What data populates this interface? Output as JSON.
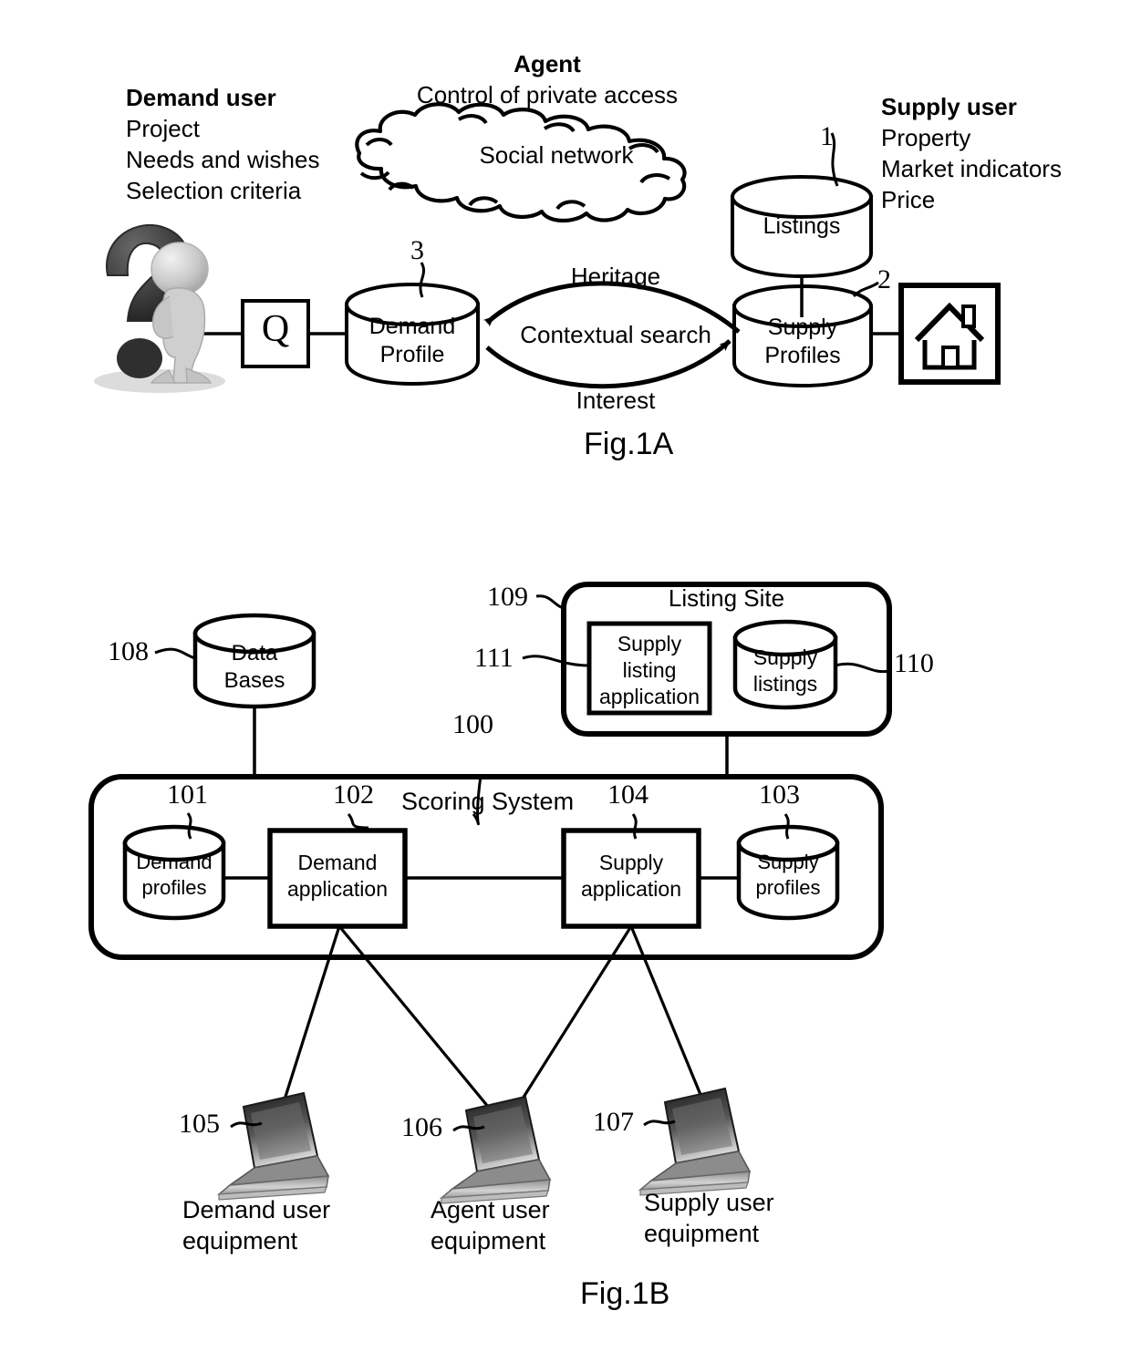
{
  "figures": {
    "fig_a": {
      "caption": "Fig.1A",
      "demand_user": {
        "title": "Demand user",
        "lines": [
          "Project",
          "Needs and wishes",
          "Selection criteria"
        ]
      },
      "agent": {
        "title": "Agent",
        "subtitle": "Control of private access"
      },
      "supply_user": {
        "title": "Supply user",
        "lines": [
          "Property",
          "Market indicators",
          "Price"
        ]
      },
      "cloud_label": "Social network",
      "search_box_label": "Q",
      "nodes": [
        {
          "id": "listings",
          "label": "Listings",
          "ref": "1"
        },
        {
          "id": "supply-profiles",
          "label_line1": "Supply",
          "label_line2": "Profiles",
          "ref": "2"
        },
        {
          "id": "demand-profile",
          "label_line1": "Demand",
          "label_line2": "Profile",
          "ref": "3"
        }
      ],
      "arrow_labels": {
        "top": "Heritage",
        "middle": "Contextual search",
        "bottom": "Interest"
      },
      "house_icon": "house-icon",
      "person_icon": "question-mark-person-icon"
    },
    "fig_b": {
      "caption": "Fig.1B",
      "databases": {
        "label_line1": "Data",
        "label_line2": "Bases",
        "ref": "108"
      },
      "listing_site": {
        "title": "Listing Site",
        "ref": "109",
        "application": {
          "line1": "Supply",
          "line2": "listing",
          "line3": "application",
          "ref": "111"
        },
        "listings_db": {
          "line1": "Supply",
          "line2": "listings",
          "ref": "110"
        }
      },
      "scoring_system": {
        "title": "Scoring System",
        "ref": "100",
        "demand_profiles": {
          "line1": "Demand",
          "line2": "profiles",
          "ref": "101"
        },
        "demand_application": {
          "line1": "Demand",
          "line2": "application",
          "ref": "102"
        },
        "supply_application": {
          "line1": "Supply",
          "line2": "application",
          "ref": "104"
        },
        "supply_profiles": {
          "line1": "Supply",
          "line2": "profiles",
          "ref": "103"
        }
      },
      "equipment": [
        {
          "id": "demand",
          "ref": "105",
          "line1": "Demand user",
          "line2": "equipment",
          "icon": "laptop-icon"
        },
        {
          "id": "agent",
          "ref": "106",
          "line1": "Agent user",
          "line2": "equipment",
          "icon": "laptop-icon"
        },
        {
          "id": "supply",
          "ref": "107",
          "line1": "Supply user",
          "line2": "equipment",
          "icon": "laptop-icon"
        }
      ]
    }
  },
  "colors": {
    "ink": "#000000",
    "paper": "#ffffff",
    "screen_dark": "#2b2b2b",
    "screen_light": "#b9b9b9",
    "body_gray": "#c9c9c9",
    "qmark_dark": "#3a3a3a"
  }
}
